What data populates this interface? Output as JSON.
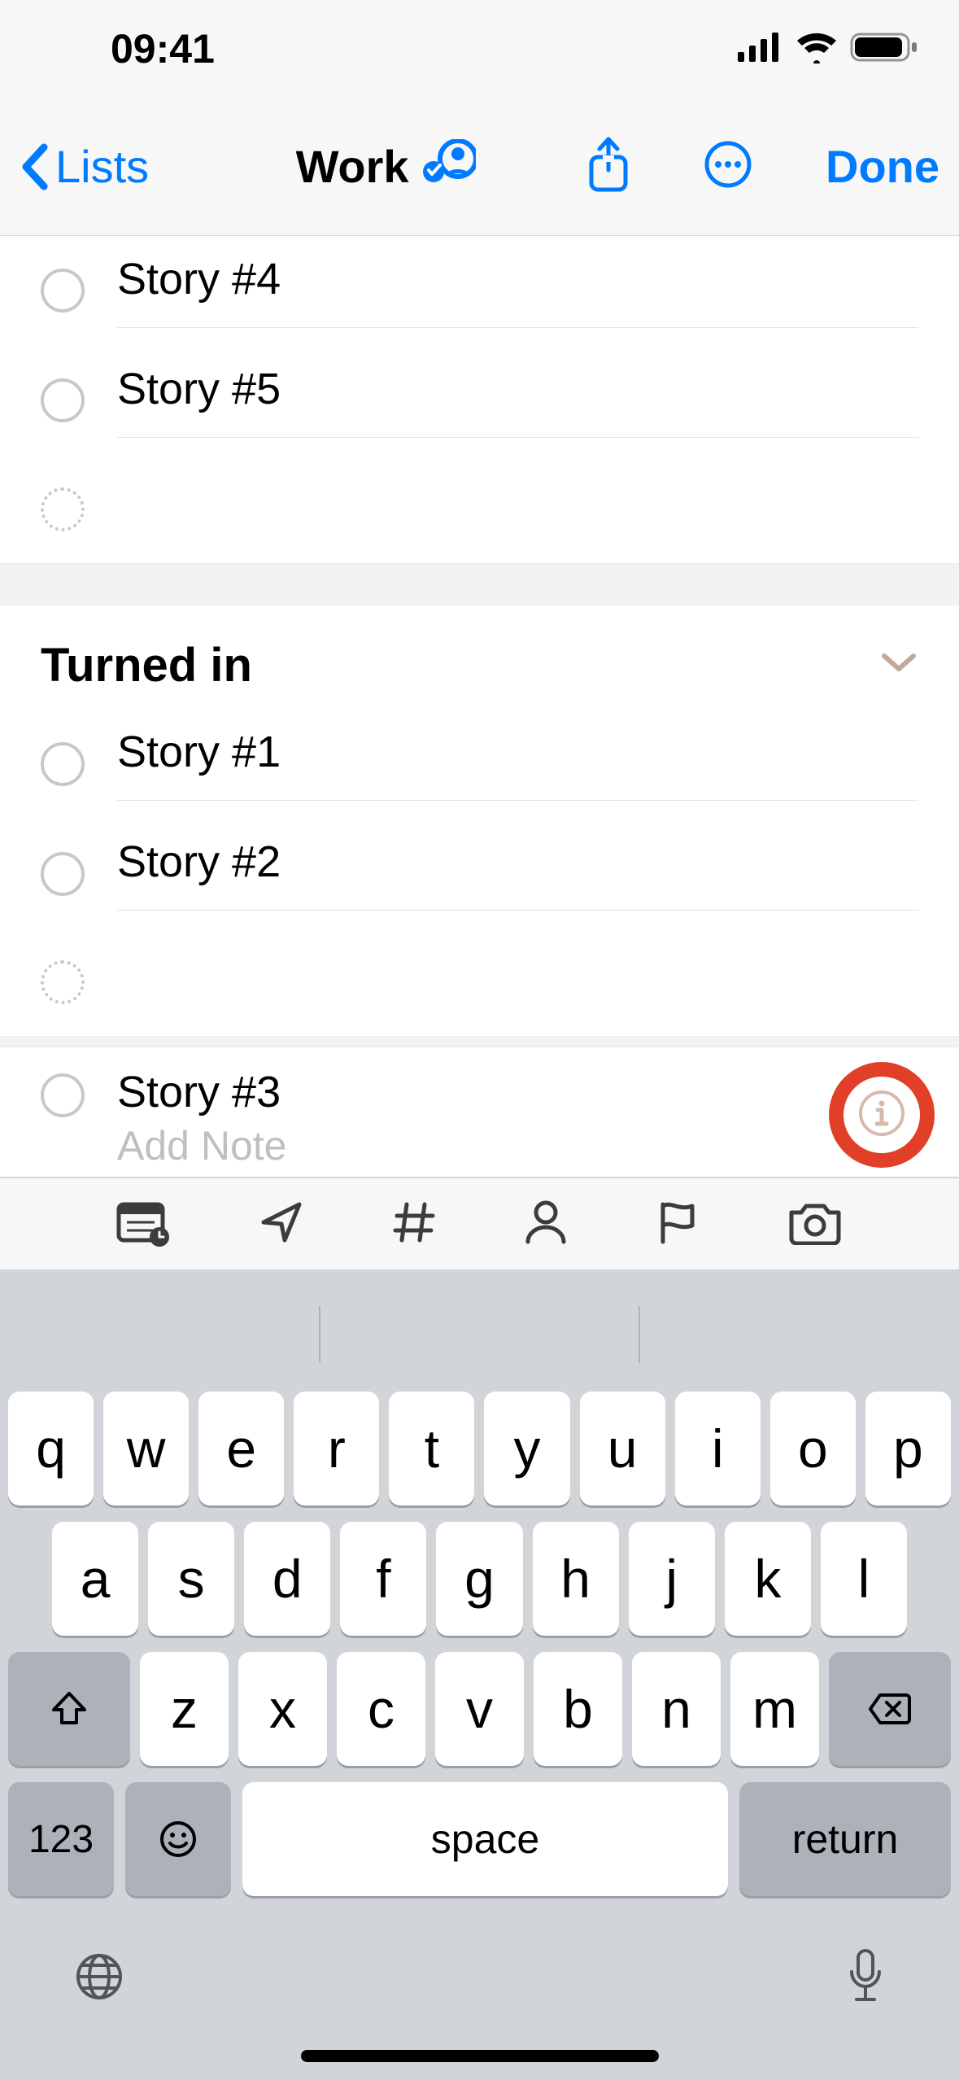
{
  "status": {
    "time": "09:41"
  },
  "nav": {
    "back_label": "Lists",
    "title": "Work",
    "done_label": "Done"
  },
  "reminders_top": [
    {
      "title": "Story #4"
    },
    {
      "title": "Story #5"
    }
  ],
  "section": {
    "title": "Turned in"
  },
  "reminders_section": [
    {
      "title": "Story #1"
    },
    {
      "title": "Story #2"
    }
  ],
  "selected": {
    "title": "Story #3",
    "note_placeholder": "Add Note"
  },
  "keyboard": {
    "row1": [
      "q",
      "w",
      "e",
      "r",
      "t",
      "y",
      "u",
      "i",
      "o",
      "p"
    ],
    "row2": [
      "a",
      "s",
      "d",
      "f",
      "g",
      "h",
      "j",
      "k",
      "l"
    ],
    "row3": [
      "z",
      "x",
      "c",
      "v",
      "b",
      "n",
      "m"
    ],
    "k123": "123",
    "space": "space",
    "return": "return"
  }
}
